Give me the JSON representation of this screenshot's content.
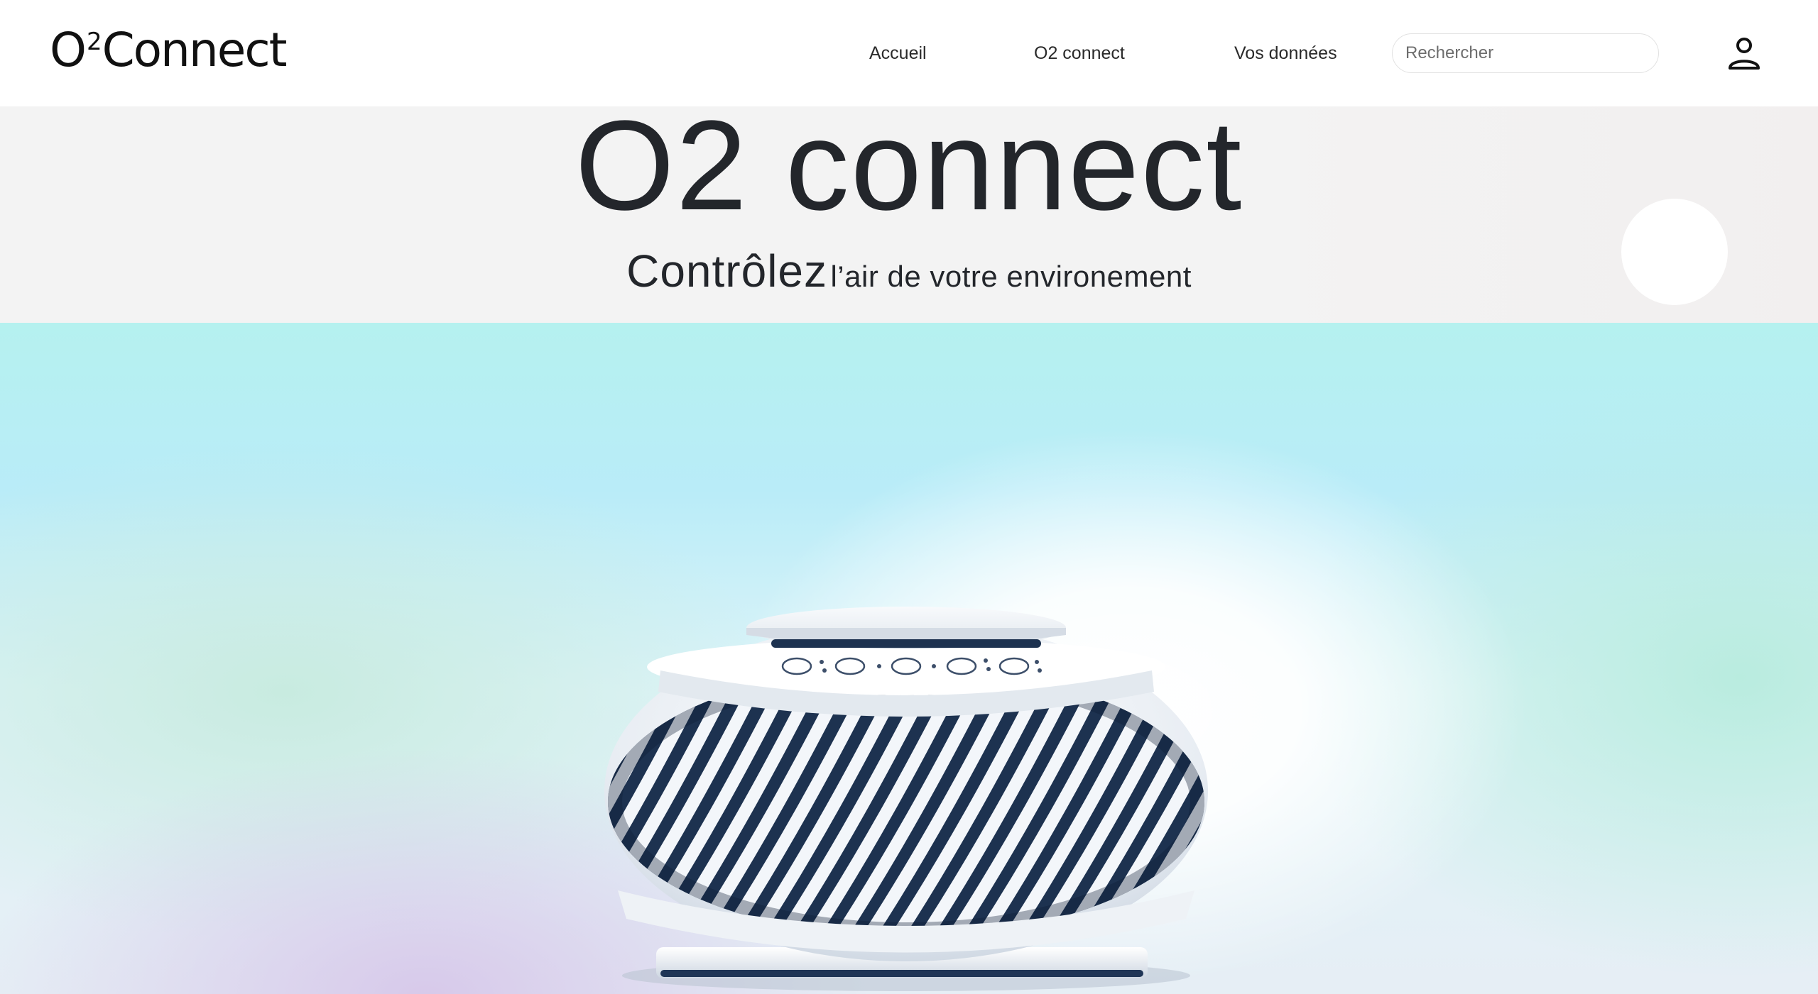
{
  "brand": {
    "logo_main": "O",
    "logo_sup": "2",
    "logo_rest": "Connect"
  },
  "nav": {
    "items": [
      {
        "label": "Accueil"
      },
      {
        "label": "O2 connect"
      },
      {
        "label": "Vos données"
      }
    ]
  },
  "search": {
    "placeholder": "Rechercher",
    "value": ""
  },
  "user": {
    "icon": "user-icon"
  },
  "hero": {
    "title": "O2 connect",
    "subtitle_big": "Contrôlez",
    "subtitle_small": "l’air de votre environement"
  },
  "product": {
    "image": "air-purifier",
    "control_icons": [
      "fan-icon",
      "power-icon",
      "mode-icon",
      "sleep-icon",
      "timer-icon"
    ]
  },
  "colors": {
    "text": "#23262b",
    "hero_bg": "#f3f3f3",
    "header_bg": "#ffffff"
  }
}
